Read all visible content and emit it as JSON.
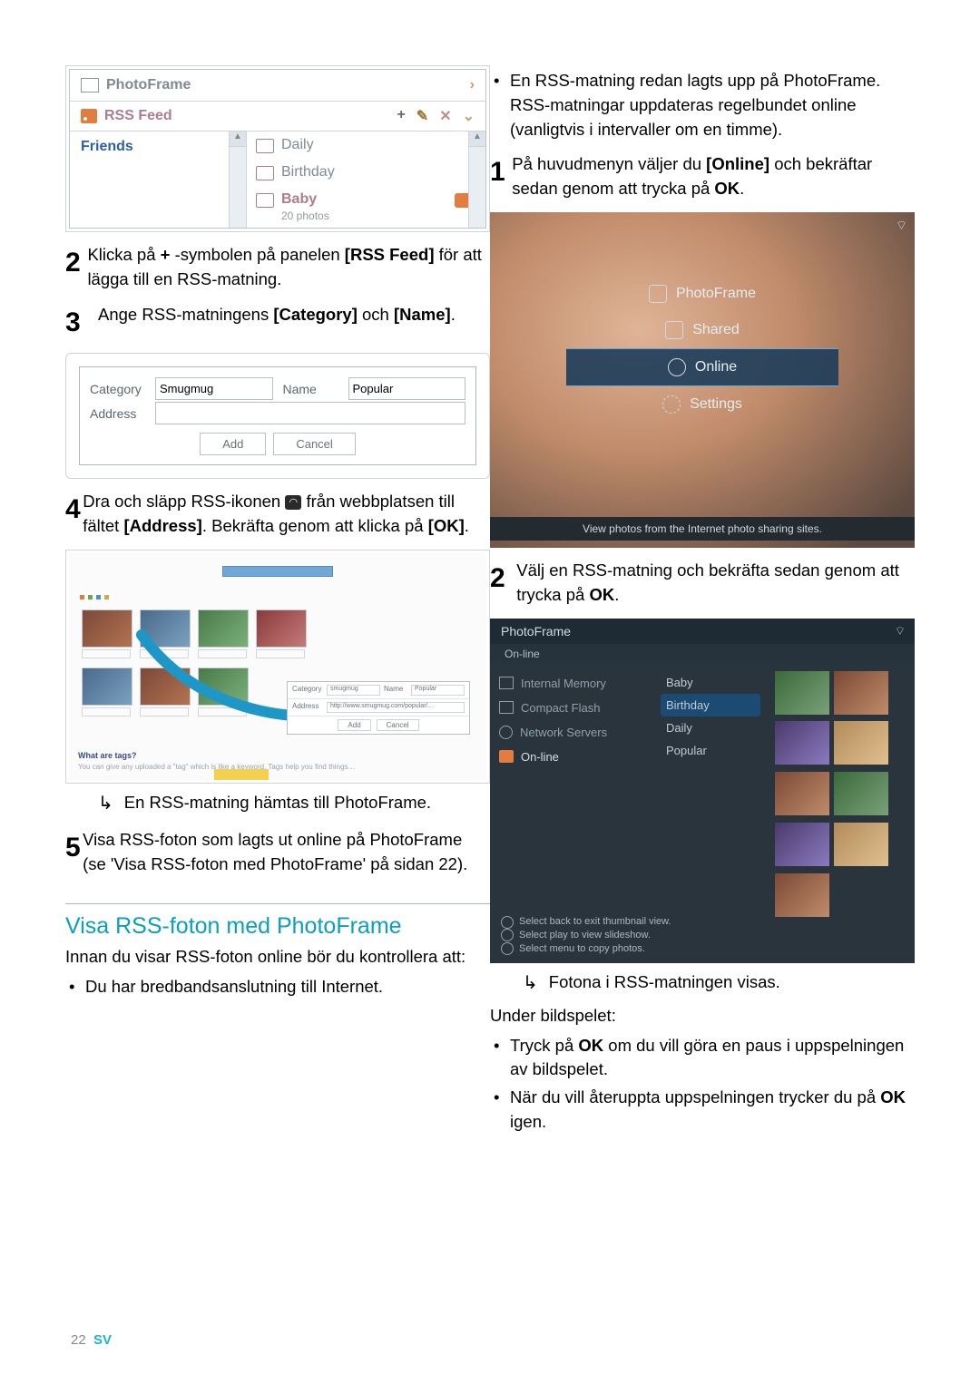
{
  "ss1": {
    "header": "PhotoFrame",
    "rss": "RSS Feed",
    "tools": {
      "plus": "+",
      "edit": "✎",
      "close": "✕",
      "down": "⌄"
    },
    "left": "Friends",
    "items": [
      {
        "label": "Daily"
      },
      {
        "label": "Birthday"
      },
      {
        "label": "Baby",
        "sub": "20 photos",
        "sel": true
      }
    ]
  },
  "steps": {
    "s2": "Klicka på + -symbolen på panelen [RSS Feed] för att lägga till en RSS-matning.",
    "s2_bold": {
      "plus": "+",
      "rss": "[RSS Feed]"
    },
    "s3": "Ange RSS-matningens [Category] och [Name].",
    "s4_a": "Dra och släpp RSS-ikonen ",
    "s4_b": " från webbplatsen till fältet [Address]. Bekräfta genom att klicka på [OK].",
    "s4_arrow": "En RSS-matning hämtas till PhotoFrame.",
    "s5": "Visa RSS-foton som lagts ut online på PhotoFrame (se 'Visa RSS-foton med PhotoFrame' på sidan 22)."
  },
  "ss2": {
    "categoryLabel": "Category",
    "categoryVal": "Smugmug",
    "nameLabel": "Name",
    "nameVal": "Popular",
    "addressLabel": "Address",
    "add": "Add",
    "cancel": "Cancel"
  },
  "ss3": {
    "add": "Add",
    "cancel": "Cancel",
    "whatAreTags": "What are tags?",
    "catLbl": "Category",
    "catVal": "smugmug",
    "nameLbl": "Name",
    "nameVal": "Popular",
    "addrLbl": "Address",
    "addrVal": "http://www.smugmug.com/popular/…"
  },
  "heading": "Visa RSS-foton med PhotoFrame",
  "intro": "Innan du visar RSS-foton online bör du kontrollera att:",
  "introBullet": "Du har bredbandsanslutning till Internet.",
  "right": {
    "pre1": "En RSS-matning redan lagts upp på PhotoFrame.",
    "pre2": "RSS-matningar uppdateras regelbundet online (vanligtvis i intervaller om en timme).",
    "r1": "På huvudmenyn väljer du [Online] och bekräftar sedan genom att trycka på OK.",
    "r2": "Välj en RSS-matning och bekräfta sedan genom att trycka på OK.",
    "arr2": "Fotona i RSS-matningen visas.",
    "under": "Under bildspelet:",
    "b1": "Tryck på OK om du vill göra en paus i uppspelningen av bildspelet.",
    "b2": "När du vill återuppta uppspelningen trycker du på OK igen."
  },
  "ss4": {
    "items": [
      "PhotoFrame",
      "Shared",
      "Online",
      "Settings"
    ],
    "bar": "View photos from the Internet photo sharing sites."
  },
  "ss5": {
    "title": "PhotoFrame",
    "sub": "On-line",
    "src": [
      "Internal Memory",
      "Compact Flash",
      "Network Servers",
      "On-line"
    ],
    "cats": [
      "Baby",
      "Birthday",
      "Daily",
      "Popular"
    ],
    "hints": [
      "Select back to exit thumbnail view.",
      "Select play to view slideshow.",
      "Select menu to copy photos."
    ]
  },
  "footer": {
    "page": "22",
    "lang": "SV"
  }
}
